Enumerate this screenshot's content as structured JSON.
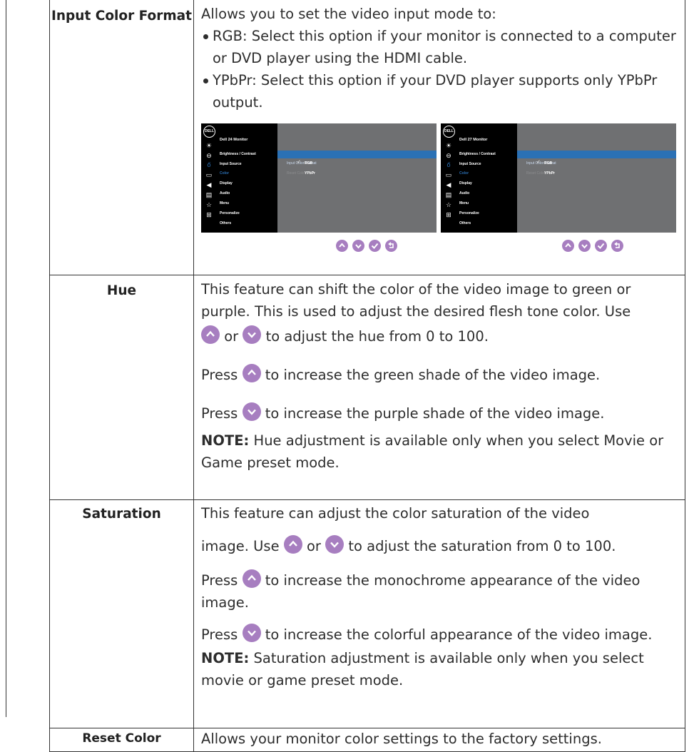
{
  "rows": {
    "input_color": {
      "label": "Input Color Format",
      "intro": "Allows you to set the video input mode to:",
      "bullets": [
        "RGB: Select this option if your monitor is connected to a computer or DVD player using the HDMI cable.",
        "YPbPr: Select this option if your DVD player supports only YPbPr output."
      ]
    },
    "hue": {
      "label": "Hue",
      "p1": "This feature can shift the color of the video image to green or purple. This is used to adjust the desired flesh tone color. Use",
      "p1_or": "or",
      "p1_end": "to adjust the hue from 0 to 100.",
      "press": "Press",
      "p2_end": "to increase the green shade of the video image.",
      "p3_end": "to increase the purple shade of the video image.",
      "note_label": "NOTE:",
      "note_text": "Hue adjustment is available only when you select Movie or Game preset mode."
    },
    "saturation": {
      "label": "Saturation",
      "p1a": "This feature can adjust the color saturation of the video",
      "p1b": "image. Use",
      "p1_or": "or",
      "p1_end": "to adjust the saturation from 0 to 100.",
      "press": "Press",
      "p2_end": "to increase the monochrome appearance of the video image.",
      "p3_end": "to increase the colorful appearance of the video image.",
      "note_label": "NOTE:",
      "note_text": "Saturation adjustment is available only when you select movie or game preset mode."
    },
    "reset": {
      "label": "Reset Color",
      "text": "Allows your monitor color settings to the factory settings."
    }
  },
  "osd": [
    {
      "logo": "DELL",
      "model": "Dell 24 Monitor",
      "menu": [
        "Brightness / Contrast",
        "Input Source",
        "Color",
        "Display",
        "Audio",
        "Menu",
        "Personalize",
        "Others"
      ],
      "selected_menu": "Color",
      "submenu": [
        "Preset Modes",
        "Input Color Format",
        "Reset Color"
      ],
      "options": [
        "RGB",
        "YPbPr"
      ],
      "checked": "✓"
    },
    {
      "logo": "DELL",
      "model": "Dell 27 Monitor",
      "menu": [
        "Brightness / Contrast",
        "Input Source",
        "Color",
        "Display",
        "Audio",
        "Menu",
        "Personalize",
        "Others"
      ],
      "selected_menu": "Color",
      "submenu": [
        "Preset Modes",
        "Input Color Format",
        "Reset Color"
      ],
      "options": [
        "RGB",
        "YPbPr"
      ],
      "checked": "✓"
    }
  ],
  "icons": {
    "up": "up-button-icon",
    "down": "down-button-icon",
    "back": "back-button-icon"
  },
  "colors": {
    "button": "#a77ec0",
    "highlight": "#2b71b5",
    "osd_bg": "#6f7072"
  }
}
